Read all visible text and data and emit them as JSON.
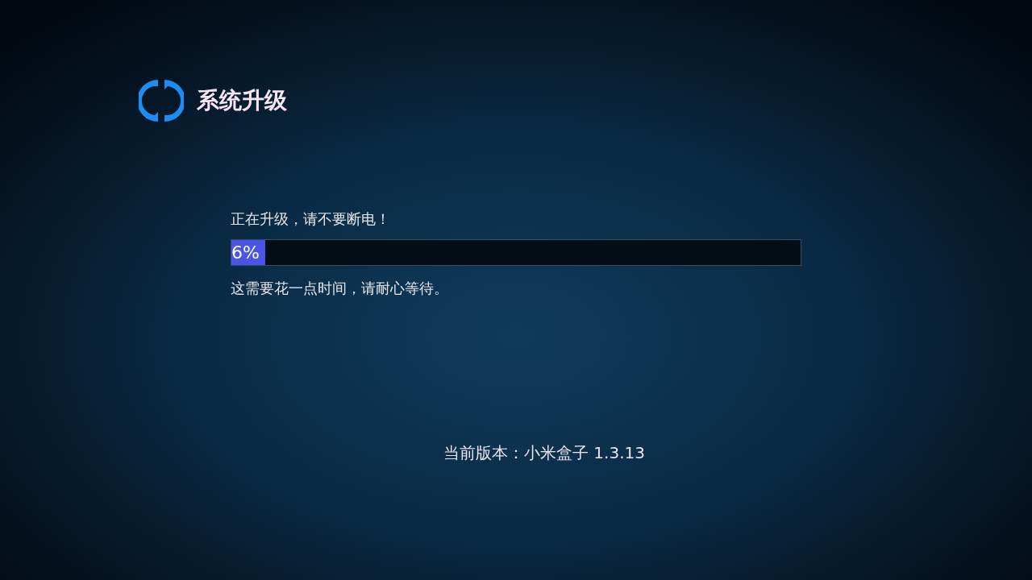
{
  "title": "系统升级",
  "warning": "正在升级，请不要断电！",
  "progress": {
    "level": 0.06,
    "reading": "6%"
  },
  "note": "这需要花一点时间，请耐心等待。",
  "version": "当前版本：小米盒子 1.3.13"
}
